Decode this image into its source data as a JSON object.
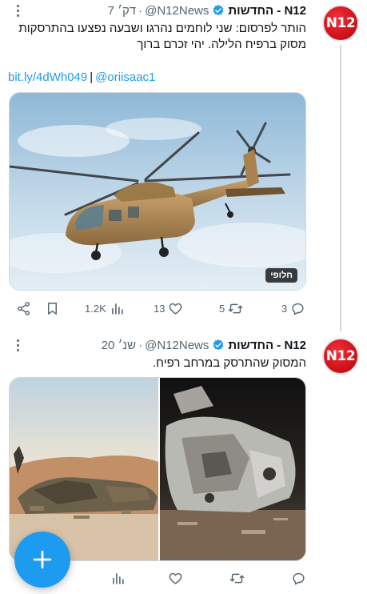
{
  "tweets": [
    {
      "author_name": "החדשות - N12",
      "handle": "@N12News",
      "separator": "·",
      "time": "7 דק׳",
      "avatar_text": "N12",
      "text_lines": [
        "הותר לפרסום: שני לוחמים נהרגו ושבעה נפצעו בהתרסקות",
        "מסוק ברפיח הלילה. יהי זכרם ברוך"
      ],
      "link": "bit.ly/4dWh049",
      "link_separator": "|",
      "mention": "@oriisaac1",
      "media_badge": "חלופי",
      "stats": {
        "views": "1.2K",
        "likes": "13",
        "retweets": "5",
        "replies": "3"
      }
    },
    {
      "author_name": "החדשות - N12",
      "handle": "@N12News",
      "separator": "·",
      "time": "20 שנ׳",
      "avatar_text": "N12",
      "text_lines": [
        "המסוק שהתרסק במרחב רפיח."
      ],
      "stats": {
        "views": "",
        "likes": "",
        "retweets": "",
        "replies": ""
      }
    }
  ],
  "fab": {
    "icon": "plus-icon"
  },
  "colors": {
    "accent": "#1d9bf0",
    "brand": "#d3141d",
    "secondary_text": "#536471"
  }
}
